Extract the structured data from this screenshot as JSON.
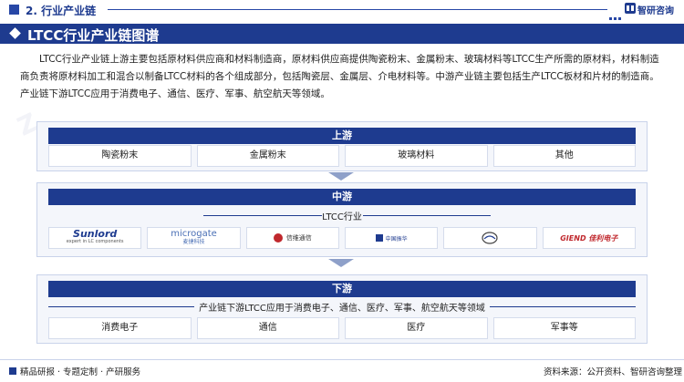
{
  "header": {
    "section_label": "2. 行业产业链",
    "brand_name": "智研咨询",
    "accent_color": "#1e3b8f"
  },
  "title": "LTCC行业产业链图谱",
  "intro": "LTCC行业产业链上游主要包括原材料供应商和材料制造商，原材料供应商提供陶瓷粉末、金属粉末、玻璃材料等LTCC生产所需的原材料，材料制造商负责将原材料加工和混合以制备LTCC材料的各个组成部分，包括陶瓷层、金属层、介电材料等。中游产业链主要包括生产LTCC板材和片材的制造商。产业链下游LTCC应用于消费电子、通信、医疗、军事、航空航天等领域。",
  "upstream": {
    "heading": "上游",
    "items": [
      "陶瓷粉末",
      "金属粉末",
      "玻璃材料",
      "其他"
    ]
  },
  "midstream": {
    "heading": "中游",
    "subtitle": "LTCC行业",
    "logos": [
      {
        "name": "Sunlord",
        "sub": "expert in LC components"
      },
      {
        "name": "microgate",
        "sub": "麦捷科技"
      },
      {
        "name": "信维通信",
        "sub": ""
      },
      {
        "name": "中国振华",
        "sub": ""
      },
      {
        "name": "",
        "sub": ""
      },
      {
        "name": "GIEND 佳利电子",
        "sub": ""
      }
    ]
  },
  "downstream": {
    "heading": "下游",
    "subtitle": "产业链下游LTCC应用于消费电子、通信、医疗、军事、航空航天等领域",
    "items": [
      "消费电子",
      "通信",
      "医疗",
      "军事等"
    ]
  },
  "footer": {
    "left": "精品研报 · 专题定制 · 产研服务",
    "source": "资料来源：公开资料、智研咨询整理"
  }
}
